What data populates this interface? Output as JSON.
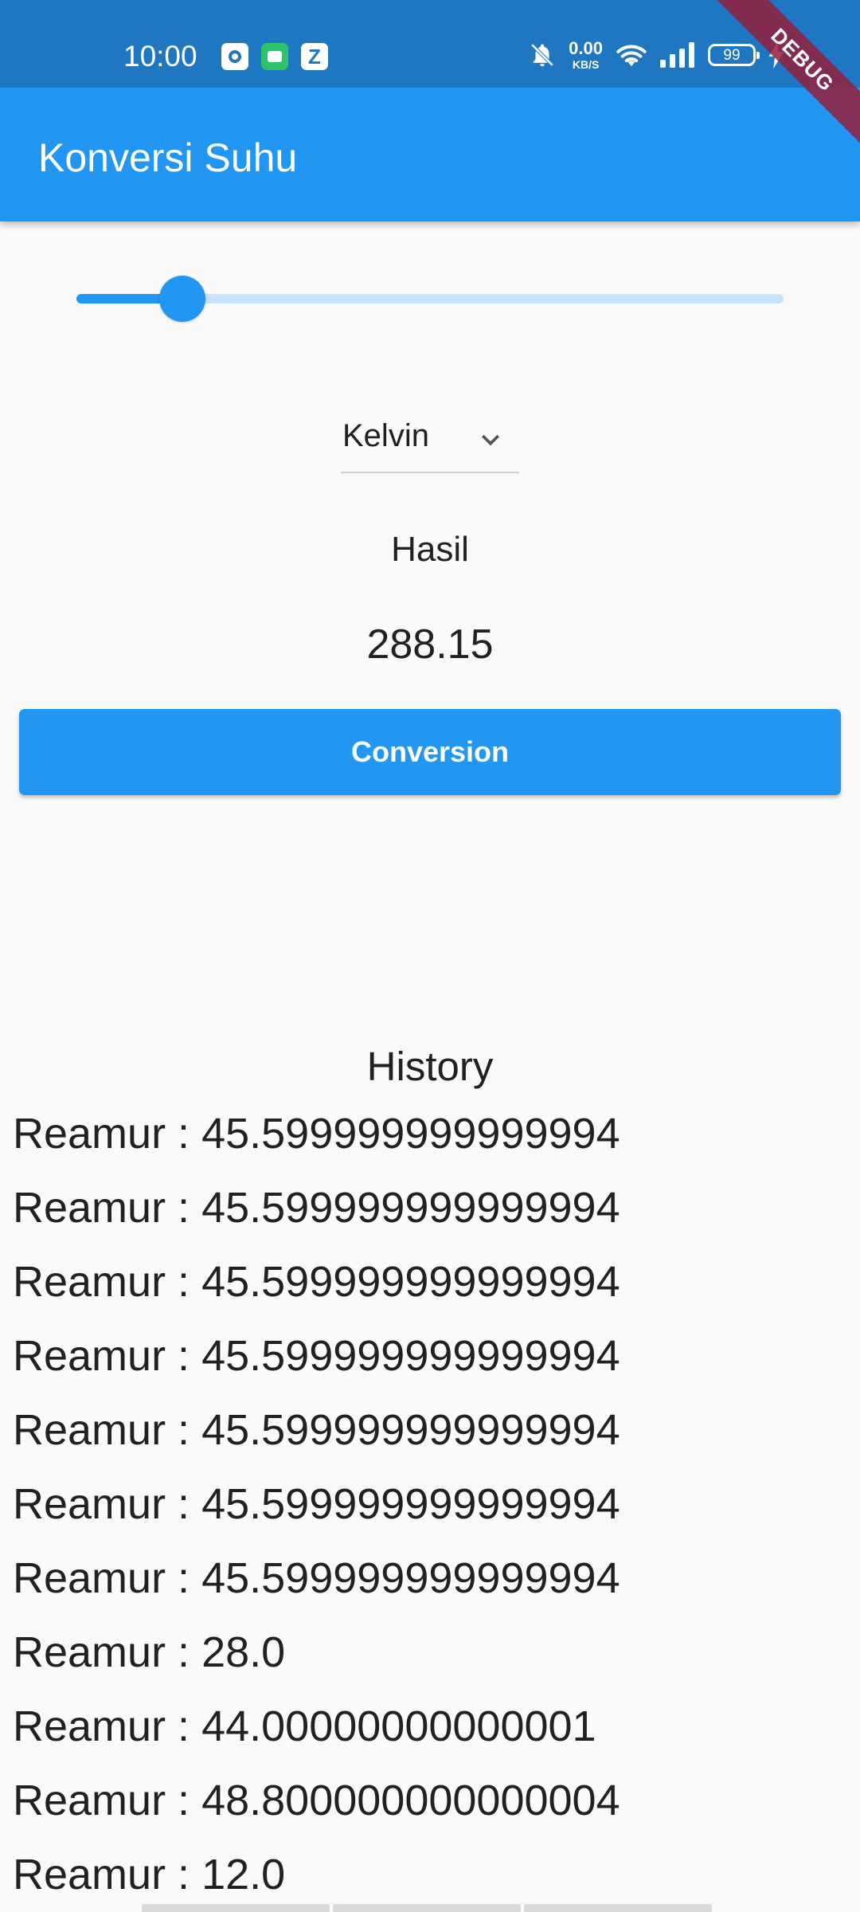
{
  "status_bar": {
    "time": "10:00",
    "net_speed_value": "0.00",
    "net_speed_unit": "KB/S",
    "battery": "99",
    "icons": [
      "camera-app-icon",
      "messages-app-icon",
      "z-app-icon",
      "bell-muted-icon",
      "wifi-icon",
      "signal-icon",
      "battery-icon",
      "charging-icon"
    ]
  },
  "debug_banner": "DEBUG",
  "app_bar": {
    "title": "Konversi Suhu"
  },
  "slider": {
    "level": 0.15
  },
  "dropdown": {
    "selected": "Kelvin",
    "icon": "chevron-down-icon"
  },
  "result": {
    "label": "Hasil",
    "value": "288.15"
  },
  "convert_button": {
    "label": "Conversion"
  },
  "history": {
    "title": "History",
    "items": [
      "Reamur : 45.599999999999994",
      "Reamur : 45.599999999999994",
      "Reamur : 45.599999999999994",
      "Reamur : 45.599999999999994",
      "Reamur : 45.599999999999994",
      "Reamur : 45.599999999999994",
      "Reamur : 45.599999999999994",
      "Reamur : 28.0",
      "Reamur : 44.00000000000001",
      "Reamur : 48.800000000000004",
      "Reamur : 12.0"
    ]
  },
  "colors": {
    "status_bar": "#1f76c1",
    "primary": "#2196f3",
    "slider_inactive": "#c6e3fb",
    "background": "#fafafa",
    "text": "#212121",
    "debug_banner": "#961e3c"
  }
}
